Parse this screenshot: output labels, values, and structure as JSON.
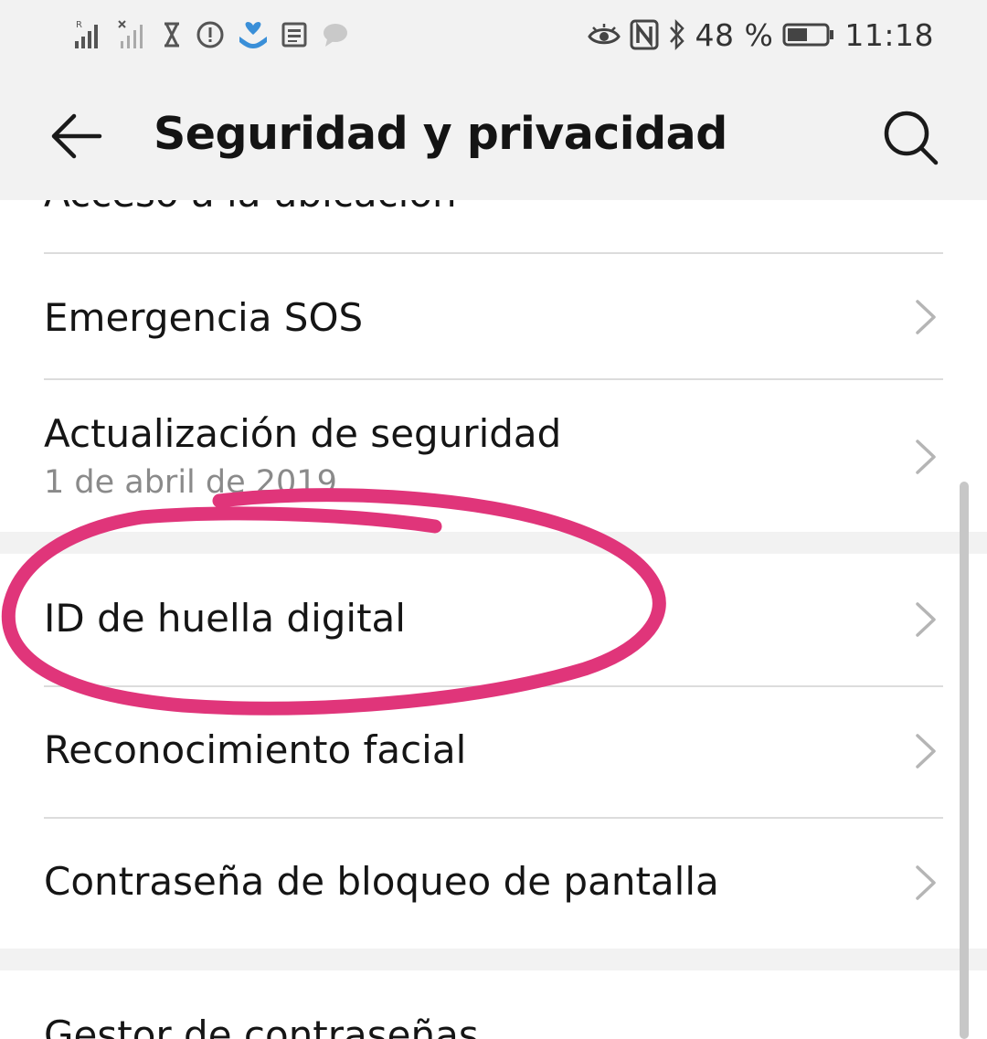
{
  "status_bar": {
    "battery_percent": "48 %",
    "time": "11:18",
    "roaming_flag": "R"
  },
  "app_bar": {
    "title": "Seguridad y privacidad"
  },
  "settings": {
    "partial_top_item": "Acceso a la ubicación",
    "items": [
      {
        "label": "Emergencia SOS"
      },
      {
        "label": "Actualización de seguridad",
        "subtitle": "1 de abril de 2019"
      },
      {
        "label": "ID de huella digital"
      },
      {
        "label": "Reconocimiento facial"
      },
      {
        "label": "Contraseña de bloqueo de pantalla"
      },
      {
        "label": "Gestor de contraseñas"
      }
    ]
  },
  "icons": [
    "signal-icon",
    "no-signal-icon",
    "hourglass-icon",
    "alert-icon",
    "heart-hands-icon",
    "news-icon",
    "chat-bubble-icon",
    "eye-icon",
    "nfc-icon",
    "bluetooth-icon",
    "battery-icon",
    "back-arrow-icon",
    "search-icon",
    "chevron-right-icon"
  ],
  "colors": {
    "annotation_circle": "#e0357a",
    "background": "#f2f2f2",
    "card": "#ffffff"
  }
}
